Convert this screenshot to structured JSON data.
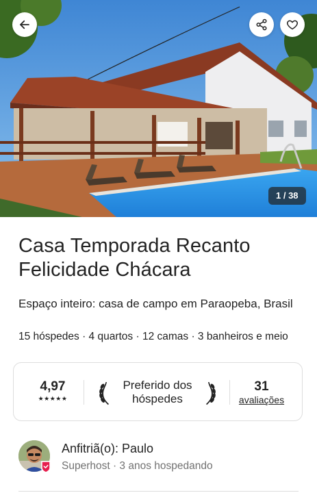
{
  "hero": {
    "photo_counter": "1 / 38",
    "icons": {
      "back": "arrow-left-icon",
      "share": "share-icon",
      "save": "heart-icon"
    }
  },
  "listing": {
    "title": "Casa Temporada Recanto Felicidade Chácara",
    "subtitle": "Espaço inteiro: casa de campo em Paraopeba, Brasil",
    "details": "15 hóspedes · 4 quartos · 12 camas · 3 banheiros e meio"
  },
  "rating_card": {
    "rating": "4,97",
    "stars": "★★★★★",
    "star_count": 5,
    "favorite_label": "Preferido dos hóspedes",
    "reviews_count": "31",
    "reviews_label": "avaliações"
  },
  "host": {
    "name_label": "Anfitriã(o): Paulo",
    "subtitle": "Superhost · 3 anos hospedando"
  },
  "colors": {
    "text_primary": "#222222",
    "text_secondary": "#717171",
    "border": "#dddddd",
    "superhost_badge": "#e61e4d"
  }
}
